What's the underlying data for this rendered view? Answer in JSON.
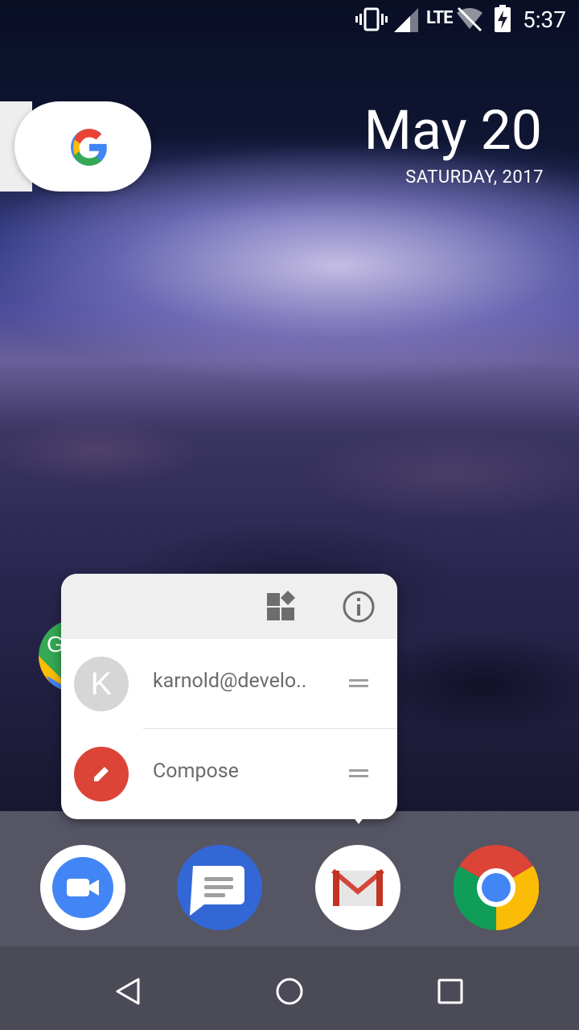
{
  "status_bar": {
    "time": "5:37",
    "network": "LTE",
    "icons": [
      "vibrate-icon",
      "cell-signal-icon",
      "wifi-off-icon",
      "battery-charging-icon"
    ]
  },
  "search_widget": {
    "icon": "google-g-icon"
  },
  "clock_widget": {
    "date": "May 20",
    "day": "SATURDAY, 2017"
  },
  "shortcuts_popup": {
    "header_icons": [
      "widgets-icon",
      "app-info-icon"
    ],
    "items": [
      {
        "label": "karnold@develo..",
        "avatar_letter": "K",
        "avatar_color": "#d0d0d0",
        "icon": "account-avatar-icon"
      },
      {
        "label": "Compose",
        "avatar_color": "#db4437",
        "icon": "pencil-icon"
      }
    ]
  },
  "dock": {
    "apps": [
      {
        "name": "Duo",
        "icon": "duo-icon"
      },
      {
        "name": "Messages",
        "icon": "messages-icon"
      },
      {
        "name": "Gmail",
        "icon": "gmail-icon"
      },
      {
        "name": "Chrome",
        "icon": "chrome-icon"
      }
    ]
  },
  "nav_bar": {
    "buttons": [
      "back-icon",
      "home-icon",
      "recents-icon"
    ]
  },
  "colors": {
    "google_blue": "#4285f4",
    "google_red": "#ea4335",
    "google_yellow": "#fbbc05",
    "google_green": "#34a853"
  }
}
